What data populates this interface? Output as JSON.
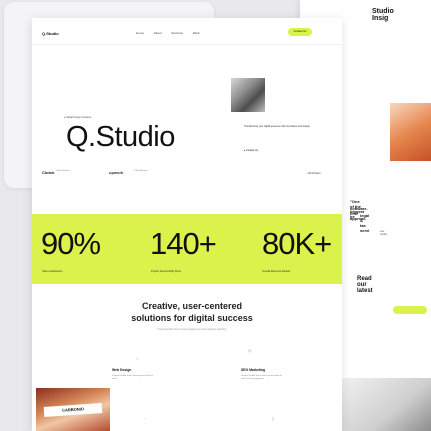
{
  "nav": {
    "logo": "Q.Studio",
    "links": [
      "Home",
      "About",
      "Services",
      "Work"
    ],
    "cta": "Contact Us"
  },
  "hero": {
    "tag": "● Digital Design Solutions",
    "brand": "Q.Studio",
    "copy": "Transforming your digital presence with innovative web design",
    "link": "● Contact Us",
    "scroll": "↓ Scroll Down"
  },
  "clients": {
    "clutch": "Clutch",
    "clutch_sub": "5 Star Reviews",
    "upwork": "upwork",
    "upwork_sub": "5 Star Reviews"
  },
  "stats": [
    {
      "num": "90%",
      "label": "Client satisfaction"
    },
    {
      "num": "140+",
      "label": "Project Successfully Done"
    },
    {
      "num": "80K+",
      "label": "Overall Revenue Raised"
    }
  ],
  "section": {
    "title_line1": "Creative, user-centered",
    "title_line2": "solutions for digital success",
    "sub": "Unique flexible Intent Local engagement and innovative solutions."
  },
  "services": [
    {
      "title": "Web Design",
      "body": "Unique flexible Intent lorem ipsum dolor sit amet"
    },
    {
      "title": "SEO Marketing",
      "body": "Unique flexible Intent lorem ipsum dolor sit amet local engagement"
    }
  ],
  "corner": {
    "label": "CARBONIO"
  },
  "right_panel": {
    "title": "Studio Insig",
    "quote_line1": "\"One of the biggest be",
    "quote_line2": "software-first approac",
    "quote_line3": "legal & tax servi",
    "author": "Lee Andra",
    "read": "Read our latest"
  }
}
